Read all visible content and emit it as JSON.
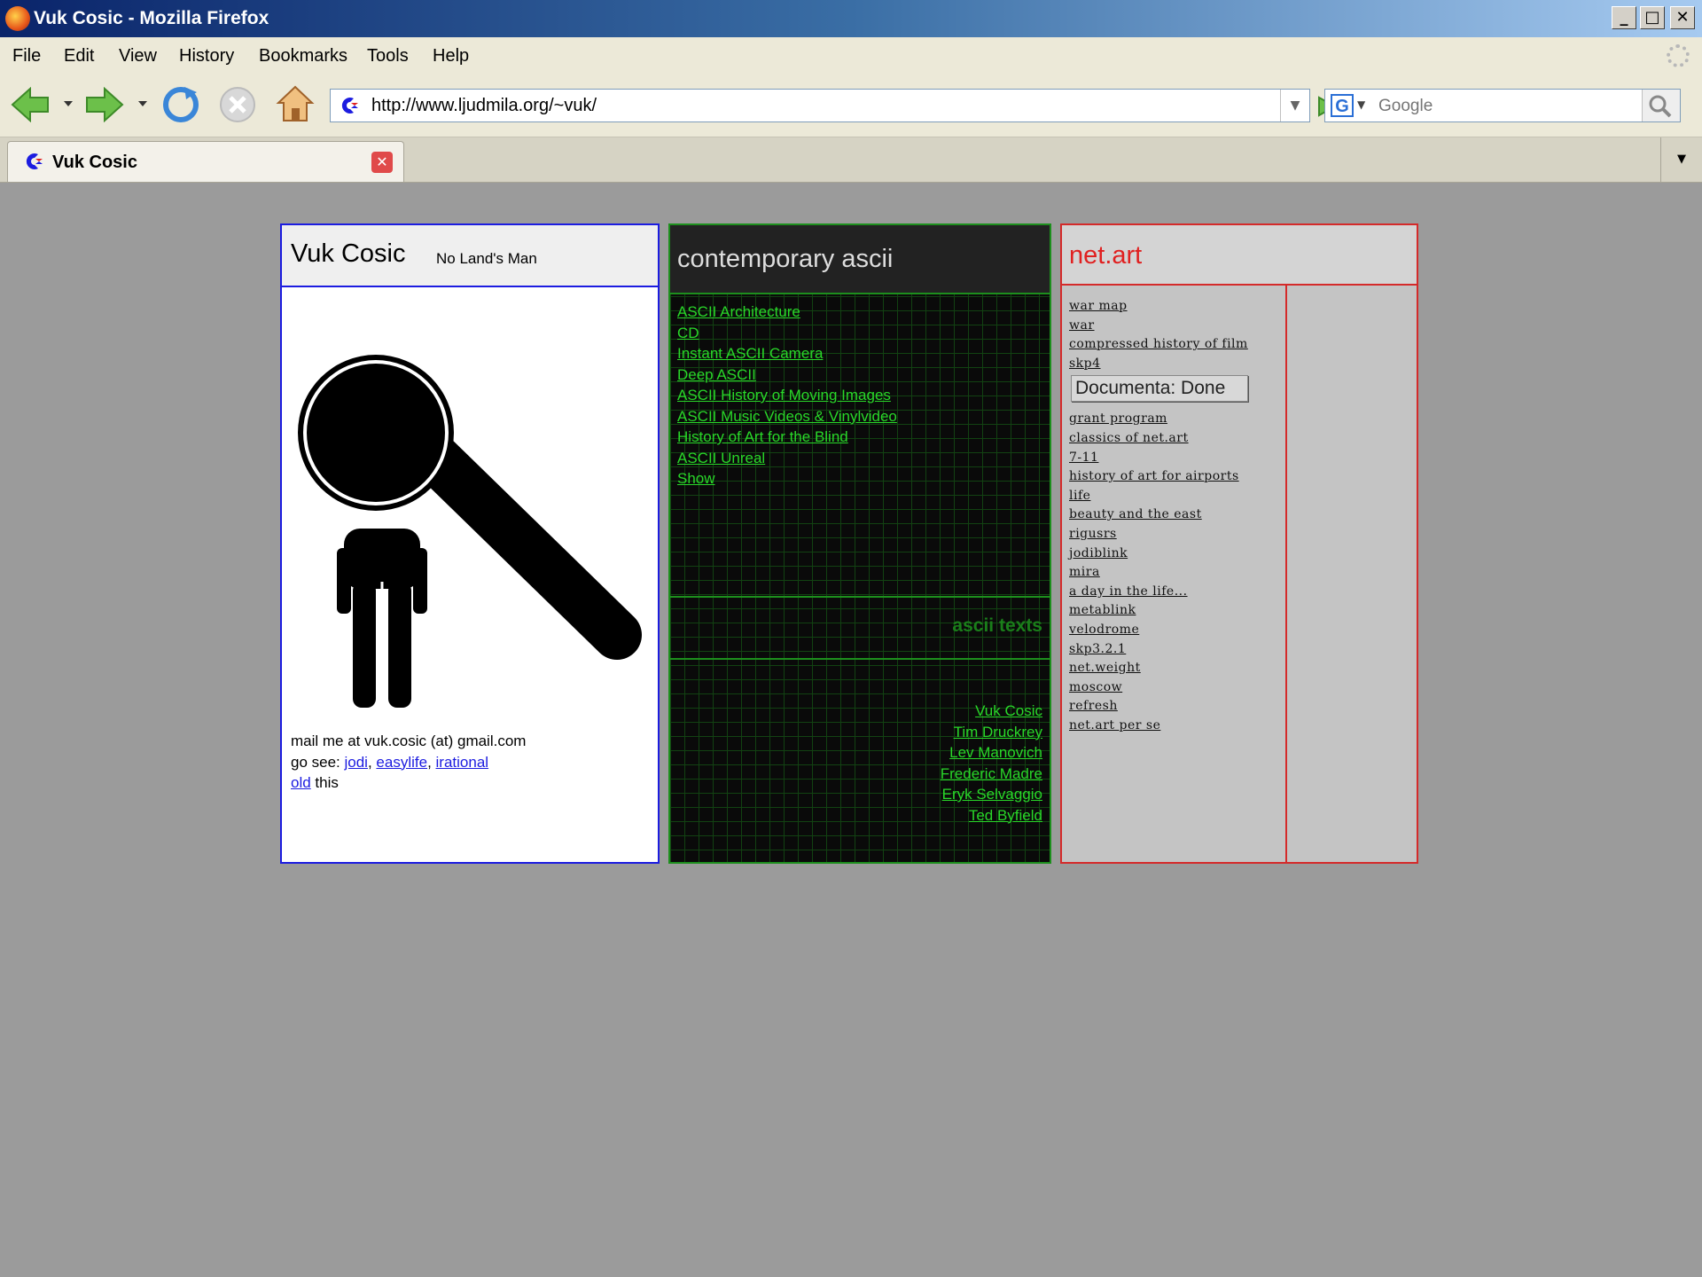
{
  "window": {
    "title": "Vuk Cosic - Mozilla Firefox"
  },
  "menu": [
    "File",
    "Edit",
    "View",
    "History",
    "Bookmarks",
    "Tools",
    "Help"
  ],
  "navigation": {
    "url": "http://www.ljudmila.org/~vuk/",
    "search_placeholder": "Google"
  },
  "tab": {
    "label": "Vuk Cosic"
  },
  "page": {
    "vuk": {
      "name": "Vuk Cosic",
      "tagline": "No Land's Man",
      "mail_text": "mail me at vuk.cosic (at) gmail.com",
      "go_see_prefix": "go see:",
      "go_see_links": [
        "jodi",
        "easylife",
        "irational"
      ],
      "old_link": "old",
      "old_suffix": "this"
    },
    "ascii": {
      "title": "contemporary ascii",
      "links": [
        "ASCII Architecture",
        "CD",
        "Instant ASCII Camera",
        "Deep ASCII",
        "ASCII History of Moving Images",
        "ASCII Music Videos & Vinylvideo",
        "History of Art for the Blind",
        "ASCII Unreal",
        "Show"
      ],
      "texts_title": "ascii texts",
      "authors": [
        "Vuk Cosic",
        "Tim Druckrey",
        "Lev Manovich",
        "Frederic Madre",
        "Eryk Selvaggio",
        "Ted Byfield"
      ]
    },
    "netart": {
      "title": "net.art",
      "links_before_tooltip": [
        "war map",
        "war",
        "compressed history of film",
        "skp4"
      ],
      "tooltip": "Documenta: Done",
      "links_after_tooltip": [
        "grant program",
        "classics of net.art",
        "7-11",
        "history of art for airports",
        "life",
        "beauty and the east",
        "rigusrs",
        "jodiblink",
        "mira",
        "a day in the life...",
        "metablink",
        "velodrome",
        "skp3.2.1",
        "net.weight",
        "moscow",
        "refresh",
        "net.art per se"
      ]
    }
  },
  "colors": {
    "vuk_border": "#1c1ce0",
    "ascii_link": "#29d829",
    "net_border": "#d42a2a"
  },
  "icons": [
    "firefox-icon",
    "back-icon",
    "forward-icon",
    "reload-icon",
    "stop-icon",
    "home-icon",
    "go-icon",
    "magnifier-icon",
    "site-favicon"
  ]
}
